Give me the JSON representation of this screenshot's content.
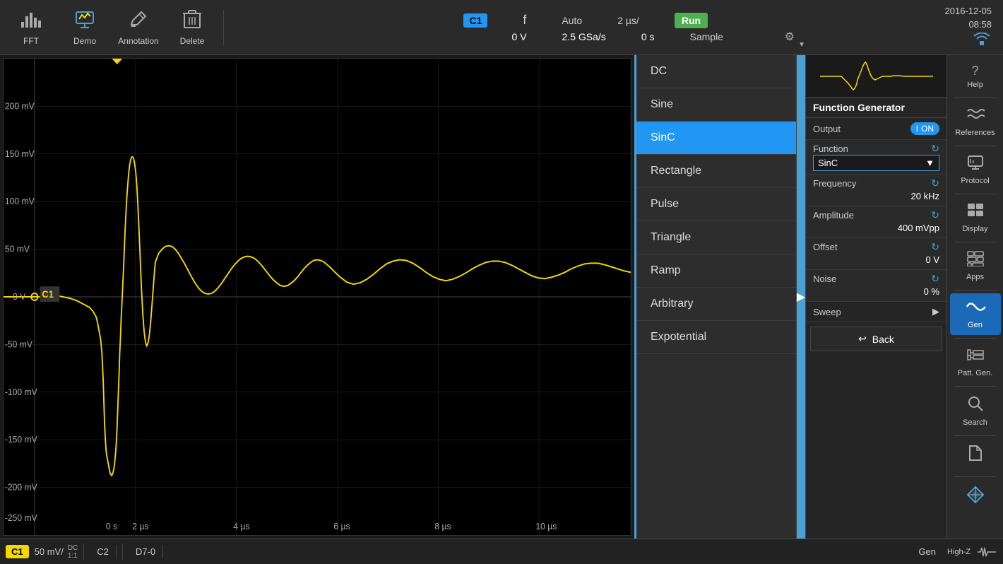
{
  "toolbar": {
    "fft_label": "FFT",
    "demo_label": "Demo",
    "annotation_label": "Annotation",
    "delete_label": "Delete",
    "channel": "C1",
    "trigger_symbol": "f",
    "timebase": "2 µs/",
    "run_label": "Run",
    "sample_label": "Sample",
    "auto_label": "Auto",
    "voltage": "0 V",
    "samplerate": "2.5 GSa/s",
    "time": "0 s",
    "date": "2016-12-05",
    "time_of_day": "08:58"
  },
  "waveform": {
    "y_labels": [
      "200 mV",
      "150 mV",
      "100 mV",
      "50 mV",
      "0 V",
      "-50 mV",
      "-100 mV",
      "-150 mV",
      "-200 mV",
      "-250 mV"
    ],
    "x_labels": [
      "0 s",
      "2 µs",
      "4 µs",
      "6 µs",
      "8 µs",
      "10 µs"
    ],
    "channel": "C1"
  },
  "dropdown": {
    "items": [
      {
        "label": "DC",
        "selected": false
      },
      {
        "label": "Sine",
        "selected": false
      },
      {
        "label": "SinC",
        "selected": true
      },
      {
        "label": "Rectangle",
        "selected": false
      },
      {
        "label": "Pulse",
        "selected": false
      },
      {
        "label": "Triangle",
        "selected": false
      },
      {
        "label": "Ramp",
        "selected": false
      },
      {
        "label": "Arbitrary",
        "selected": false
      },
      {
        "label": "Expotential",
        "selected": false
      }
    ]
  },
  "function_generator": {
    "title": "Function Generator",
    "output_label": "Output",
    "output_state": "ON",
    "function_label": "Function",
    "function_value": "SinC",
    "frequency_label": "Frequency",
    "frequency_value": "20 kHz",
    "amplitude_label": "Amplitude",
    "amplitude_value": "400 mVpp",
    "offset_label": "Offset",
    "offset_value": "0 V",
    "noise_label": "Noise",
    "noise_value": "0 %",
    "sweep_label": "Sweep",
    "back_label": "Back"
  },
  "sidebar": {
    "items": [
      {
        "label": "? Help",
        "icon": "?",
        "active": false
      },
      {
        "label": "References",
        "icon": "∿∿",
        "active": false
      },
      {
        "label": "Protocol",
        "icon": "🖥",
        "active": false
      },
      {
        "label": "Display",
        "icon": "⠿",
        "active": false
      },
      {
        "label": "Apps",
        "icon": "⠿",
        "active": false
      },
      {
        "label": "Gen",
        "icon": "~",
        "active": true
      },
      {
        "label": "Patt. Gen.",
        "icon": "≡",
        "active": false
      },
      {
        "label": "Search",
        "icon": "🔍",
        "active": false
      },
      {
        "label": "",
        "icon": "📁",
        "active": false
      },
      {
        "label": "",
        "icon": "◈",
        "active": false
      }
    ]
  },
  "statusbar": {
    "channel": "C1",
    "scale": "50 mV/",
    "dc": "DC",
    "ratio": "1:1",
    "ch2": "C2",
    "d7_0": "D7-0",
    "gen": "Gen",
    "highz": "High-Z"
  }
}
